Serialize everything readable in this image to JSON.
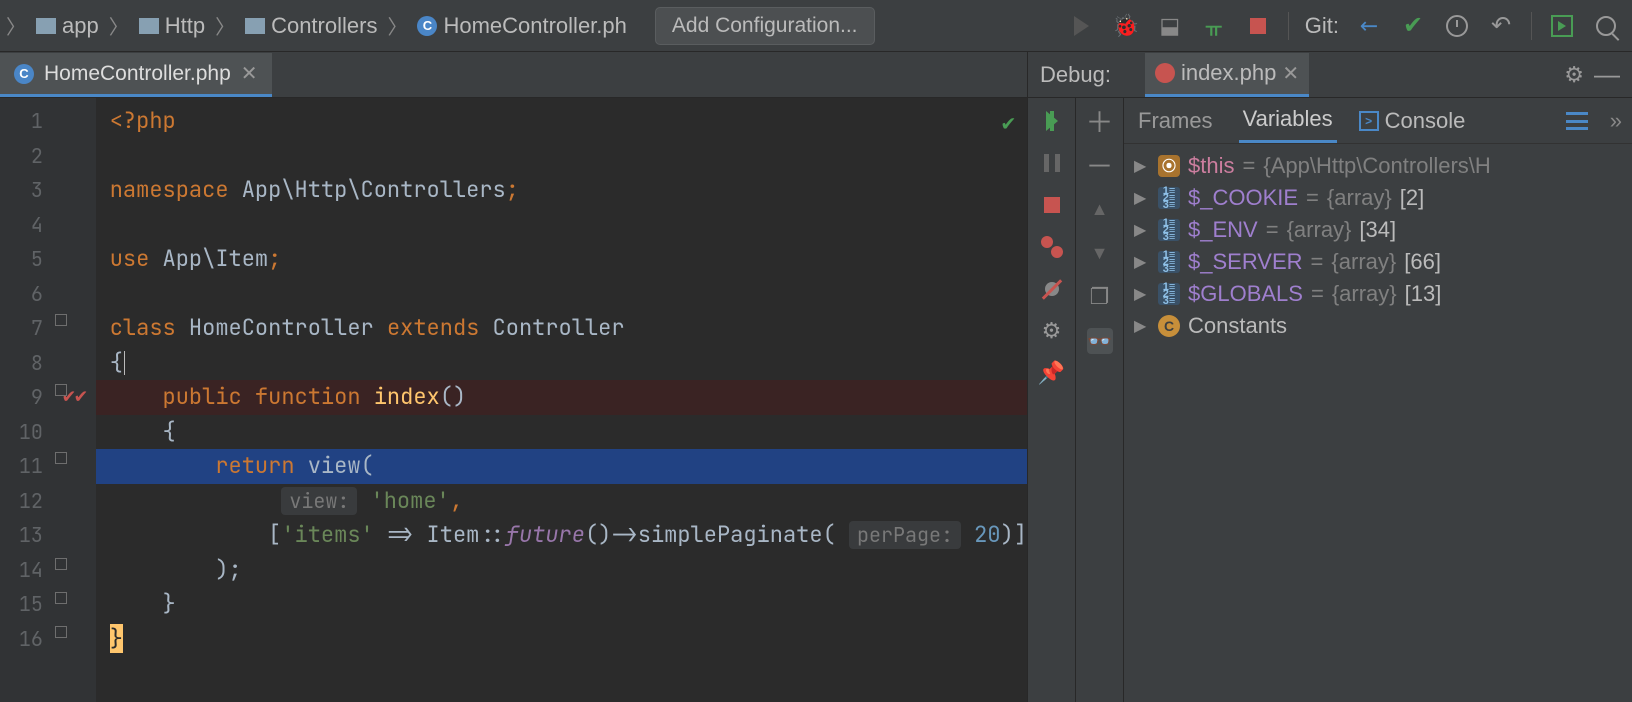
{
  "breadcrumbs": [
    "app",
    "Http",
    "Controllers",
    "HomeController.ph"
  ],
  "add_config_label": "Add Configuration...",
  "git_label": "Git:",
  "editor_tab": {
    "filename": "HomeController.php"
  },
  "gutter_lines": [
    "1",
    "2",
    "3",
    "4",
    "5",
    "6",
    "7",
    "8",
    "9",
    "10",
    "11",
    "12",
    "13",
    "14",
    "15",
    "16"
  ],
  "code": {
    "l1": "<?php",
    "l3_ns": "namespace ",
    "l3_p": "App\\Http\\Controllers",
    "l5_use": "use ",
    "l5_p": "App\\Item",
    "l7_class": "class ",
    "l7_name": "HomeController ",
    "l7_ext": "extends ",
    "l7_parent": "Controller",
    "l8": "{",
    "l9_pub": "    public ",
    "l9_fn": "function ",
    "l9_name": "index",
    "l9_par": "()",
    "l10": "    {",
    "l11_ret": "        return ",
    "l11_view": "view",
    "l11_open": "(",
    "l12_hint": "view:",
    "l12_str": "'home'",
    "l12_c": ",",
    "l13_open": "            [",
    "l13_key": "'items' ",
    "l13_arrow": "=> Item::",
    "l13_fu": "future",
    "l13_call": "()->simplePaginate( ",
    "l13_hint": "perPage:",
    "l13_num": "20",
    "l13_close": ")]",
    "l14": "        );",
    "l15": "    }",
    "l16": "}"
  },
  "debug": {
    "title": "Debug:",
    "session": "index.php",
    "tabs": {
      "frames": "Frames",
      "variables": "Variables",
      "console": "Console"
    },
    "vars": [
      {
        "kind": "f",
        "name": "$this",
        "val": "{App\\Http\\Controllers\\H",
        "count": ""
      },
      {
        "kind": "a",
        "name": "$_COOKIE",
        "val": "{array}",
        "count": "[2]"
      },
      {
        "kind": "a",
        "name": "$_ENV",
        "val": "{array}",
        "count": "[34]"
      },
      {
        "kind": "a",
        "name": "$_SERVER",
        "val": "{array}",
        "count": "[66]"
      },
      {
        "kind": "a",
        "name": "$GLOBALS",
        "val": "{array}",
        "count": "[13]"
      },
      {
        "kind": "c",
        "name": "Constants",
        "val": "",
        "count": ""
      }
    ]
  }
}
